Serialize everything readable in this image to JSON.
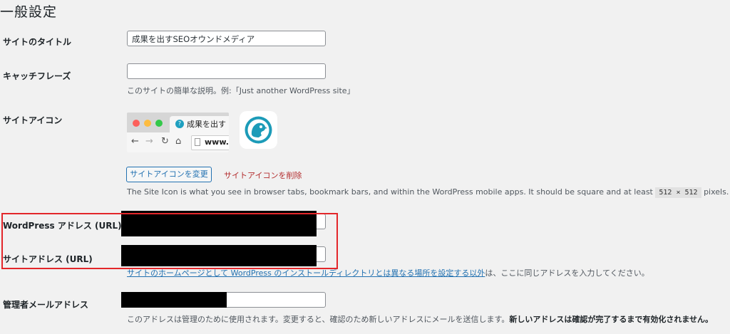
{
  "page": {
    "title": "一般設定"
  },
  "site_title": {
    "label": "サイトのタイトル",
    "value": "成果を出すSEOオウンドメディア"
  },
  "tagline": {
    "label": "キャッチフレーズ",
    "value": "",
    "description": "このサイトの簡単な説明。例:「Just another WordPress site」"
  },
  "site_icon": {
    "label": "サイトアイコン",
    "browser_tab_text": "成果を出す",
    "browser_url_text": "www.",
    "change_button": "サイトアイコンを変更",
    "delete_link": "サイトアイコンを削除",
    "description_before": "The Site Icon is what you see in browser tabs, bookmark bars, and within the WordPress mobile apps. It should be square and at least",
    "description_size": "512 × 512",
    "description_after": "pixels."
  },
  "wp_address": {
    "label": "WordPress アドレス (URL)"
  },
  "site_address": {
    "label": "サイトアドレス (URL)",
    "description_link": "サイトのホームページとして WordPress のインストールディレクトリとは異なる場所を設定する以外",
    "description_rest": "は、ここに同じアドレスを入力してください。"
  },
  "admin_email": {
    "label": "管理者メールアドレス",
    "description": "このアドレスは管理のために使用されます。変更すると、確認のため新しいアドレスにメールを送信します。",
    "description_bold": "新しいアドレスは確認が完了するまで有効化されません。"
  },
  "colors": {
    "accent": "#2271b1",
    "danger": "#b32d2e",
    "highlight": "#e3262a"
  }
}
